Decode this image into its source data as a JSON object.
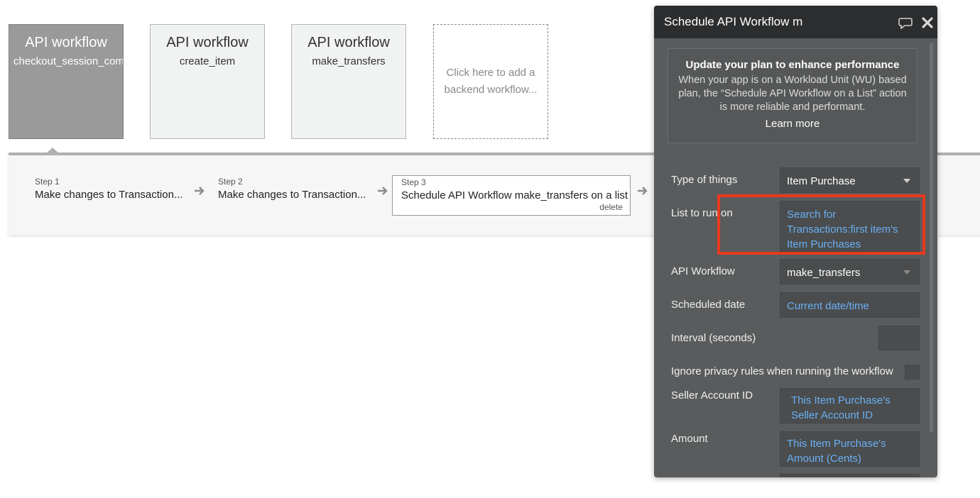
{
  "workflows": [
    {
      "title": "API workflow",
      "name": "checkout_session_com"
    },
    {
      "title": "API workflow",
      "name": "create_item"
    },
    {
      "title": "API workflow",
      "name": "make_transfers"
    }
  ],
  "add_workflow": {
    "label": "Click here to add a backend workflow..."
  },
  "steps": [
    {
      "number": "Step 1",
      "text": "Make changes to Transaction..."
    },
    {
      "number": "Step 2",
      "text": "Make changes to Transaction..."
    },
    {
      "number": "Step 3",
      "text": "Schedule API Workflow make_transfers on a list",
      "delete": "delete"
    }
  ],
  "panel": {
    "title": "Schedule API Workflow m",
    "notice": {
      "title": "Update your plan to enhance performance",
      "body": "When your app is on a Workload Unit (WU) based plan, the “Schedule API Workflow on a List” action is more reliable and performant.",
      "link": "Learn more"
    },
    "fields": {
      "type_label": "Type of things",
      "type_value": "Item Purchase",
      "list_label": "List to run on",
      "list_value": "Search for Transactions:first item's Item Purchases",
      "api_label": "API Workflow",
      "api_value": "make_transfers",
      "date_label": "Scheduled date",
      "date_value": "Current date/time",
      "interval_label": "Interval (seconds)",
      "interval_value": "",
      "privacy_label": "Ignore privacy rules when running the workflow",
      "seller_label": "Seller Account ID",
      "seller_value": "This Item Purchase's Seller Account ID",
      "amount_label": "Amount",
      "amount_value": "This Item Purchase's Amount (Cents)"
    }
  },
  "colors": {
    "panel_bg": "#595b5c",
    "header_bg": "#2c2d2e",
    "dynamic_text": "#6ab0f5",
    "highlight": "#e83a1e"
  }
}
